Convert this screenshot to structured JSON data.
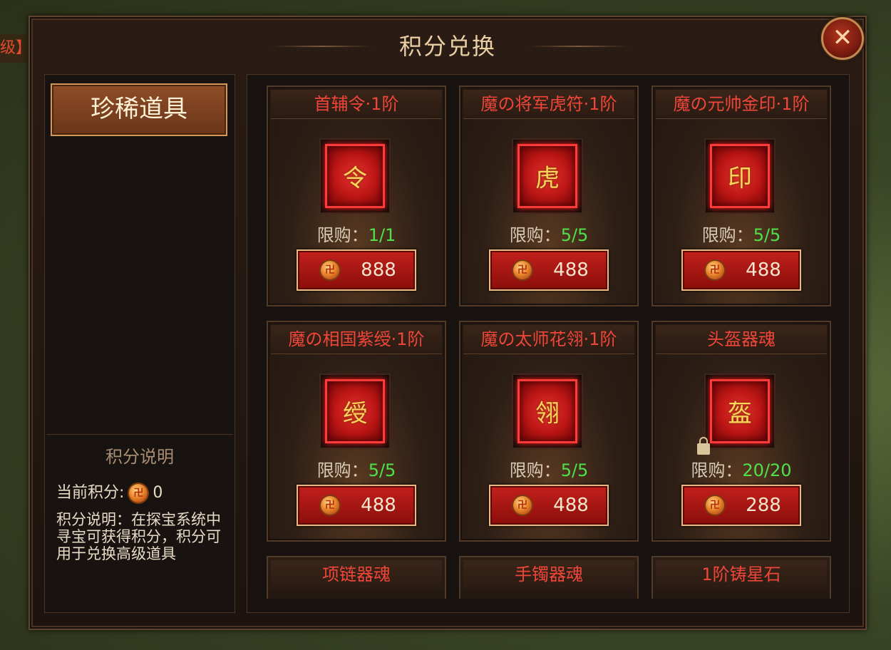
{
  "background": {
    "edge_tag": "级】"
  },
  "window": {
    "title": "积分兑换",
    "close_icon": "✕"
  },
  "sidebar": {
    "category_label": "珍稀道具",
    "info_title": "积分说明",
    "current_points_label": "当前积分:",
    "current_points_value": "0",
    "description": "积分说明：在探宝系统中寻宝可获得积分，积分可用于兑换高级道具"
  },
  "limit_label": "限购：",
  "items": [
    {
      "name": "首辅令·1阶",
      "limit": "1/1",
      "price": "888",
      "icon": "token-icon",
      "glyph": "令",
      "locked": false
    },
    {
      "name": "魔の将军虎符·1阶",
      "limit": "5/5",
      "price": "488",
      "icon": "tiger-tally-icon",
      "glyph": "虎",
      "locked": false
    },
    {
      "name": "魔の元帅金印·1阶",
      "limit": "5/5",
      "price": "488",
      "icon": "golden-seal-icon",
      "glyph": "印",
      "locked": false
    },
    {
      "name": "魔の相国紫绶·1阶",
      "limit": "5/5",
      "price": "488",
      "icon": "purple-ribbon-icon",
      "glyph": "绶",
      "locked": false
    },
    {
      "name": "魔の太师花翎·1阶",
      "limit": "5/5",
      "price": "488",
      "icon": "feather-icon",
      "glyph": "翎",
      "locked": false
    },
    {
      "name": "头盔器魂",
      "limit": "20/20",
      "price": "288",
      "icon": "helmet-icon",
      "glyph": "盔",
      "locked": true
    }
  ],
  "partial_items": [
    {
      "name": "项链器魂"
    },
    {
      "name": "手镯器魂"
    },
    {
      "name": "1阶铸星石"
    }
  ],
  "colors": {
    "item_name": "#f0463a",
    "limit_value": "#4fe04a",
    "button_red": "#c3201c"
  }
}
